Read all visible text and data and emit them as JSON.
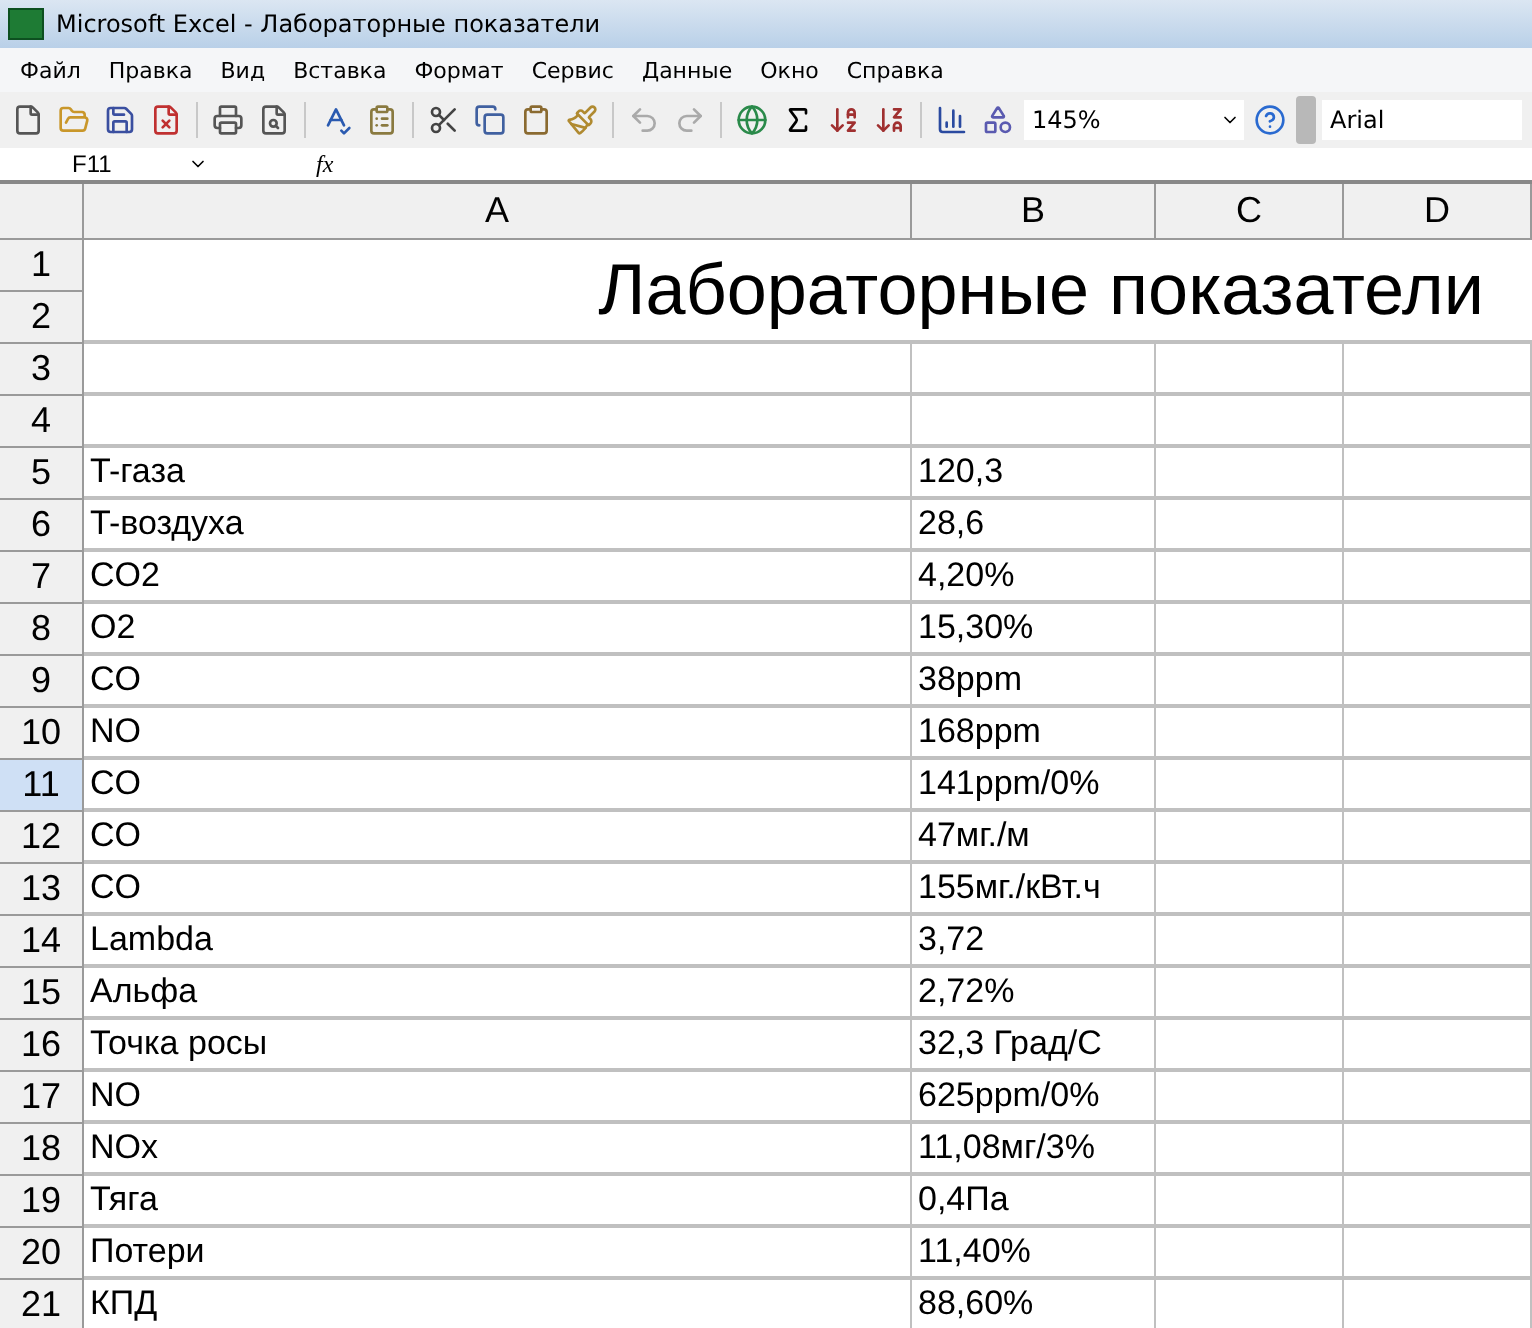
{
  "window": {
    "title": "Microsoft Excel - Лабораторные показатели"
  },
  "menu": [
    {
      "label": "Файл"
    },
    {
      "label": "Правка"
    },
    {
      "label": "Вид"
    },
    {
      "label": "Вставка"
    },
    {
      "label": "Формат"
    },
    {
      "label": "Сервис"
    },
    {
      "label": "Данные"
    },
    {
      "label": "Окно"
    },
    {
      "label": "Справка"
    }
  ],
  "toolbar": {
    "zoom": "145%",
    "font": "Arial"
  },
  "formula_bar": {
    "name_box": "F11",
    "fx": "fx"
  },
  "columns": [
    {
      "label": "A"
    },
    {
      "label": "B"
    },
    {
      "label": "C"
    },
    {
      "label": "D"
    }
  ],
  "title": "Лабораторные показатели",
  "title_rows": [
    {
      "label": "1",
      "selected": false
    },
    {
      "label": "2",
      "selected": false
    }
  ],
  "rows": [
    {
      "label": "3",
      "selected": false,
      "a": "",
      "b": ""
    },
    {
      "label": "4",
      "selected": false,
      "a": "",
      "b": ""
    },
    {
      "label": "5",
      "selected": false,
      "a": "T-газа",
      "b": "120,3"
    },
    {
      "label": "6",
      "selected": false,
      "a": "T-воздуха",
      "b": "28,6"
    },
    {
      "label": "7",
      "selected": false,
      "a": "CO2",
      "b": "4,20%"
    },
    {
      "label": "8",
      "selected": false,
      "a": "O2",
      "b": "15,30%"
    },
    {
      "label": "9",
      "selected": false,
      "a": "CO",
      "b": "38ppm"
    },
    {
      "label": "10",
      "selected": false,
      "a": "NO",
      "b": "168ppm"
    },
    {
      "label": "11",
      "selected": true,
      "a": "CO",
      "b": "141ppm/0%"
    },
    {
      "label": "12",
      "selected": false,
      "a": "CO",
      "b": "47мг./м"
    },
    {
      "label": "13",
      "selected": false,
      "a": "CO",
      "b": "155мг./кВт.ч"
    },
    {
      "label": "14",
      "selected": false,
      "a": "Lambda",
      "b": "3,72"
    },
    {
      "label": "15",
      "selected": false,
      "a": "Альфа",
      "b": "2,72%"
    },
    {
      "label": "16",
      "selected": false,
      "a": "Точка росы",
      "b": "32,3 Град/С"
    },
    {
      "label": "17",
      "selected": false,
      "a": "NO",
      "b": "625ppm/0%"
    },
    {
      "label": "18",
      "selected": false,
      "a": "NOx",
      "b": "11,08мг/3%"
    },
    {
      "label": "19",
      "selected": false,
      "a": "Тяга",
      "b": "0,4Па"
    },
    {
      "label": "20",
      "selected": false,
      "a": "Потери",
      "b": "11,40%"
    },
    {
      "label": "21",
      "selected": false,
      "a": "КПД",
      "b": "88,60%"
    }
  ]
}
